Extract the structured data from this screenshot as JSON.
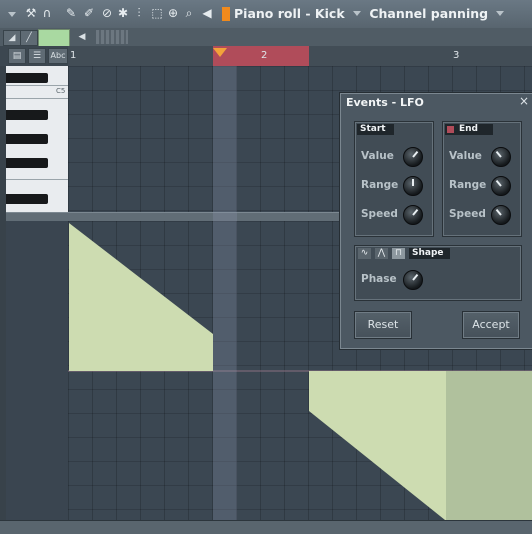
{
  "toolbar": {
    "title": "Piano roll - Kick",
    "separator": "-",
    "target": "Channel panning",
    "icons": [
      "menu-arrow-icon",
      "wrench-icon",
      "magnet-icon",
      "pencil-icon",
      "brush-icon",
      "mute-icon",
      "speaker-icon",
      "slice-icon",
      "select-icon",
      "zoom-icon",
      "playback-icon"
    ]
  },
  "secondary": {
    "abc_label": "Abc"
  },
  "timeline": {
    "bars": [
      "1",
      "2",
      "3"
    ]
  },
  "keys": {
    "c5_label": "C5"
  },
  "dialog": {
    "title": "Events - LFO",
    "close": "×",
    "start": {
      "header": "Start",
      "value_label": "Value",
      "range_label": "Range",
      "speed_label": "Speed"
    },
    "end": {
      "header": "End",
      "value_label": "Value",
      "range_label": "Range",
      "speed_label": "Speed"
    },
    "shape": {
      "header": "Shape",
      "phase_label": "Phase"
    },
    "reset_label": "Reset",
    "accept_label": "Accept"
  },
  "colors": {
    "event_fill": "#cddcb1",
    "loop_region": "#b04c5a",
    "playhead": "#f3a23a",
    "accent": "#f08a1c"
  }
}
